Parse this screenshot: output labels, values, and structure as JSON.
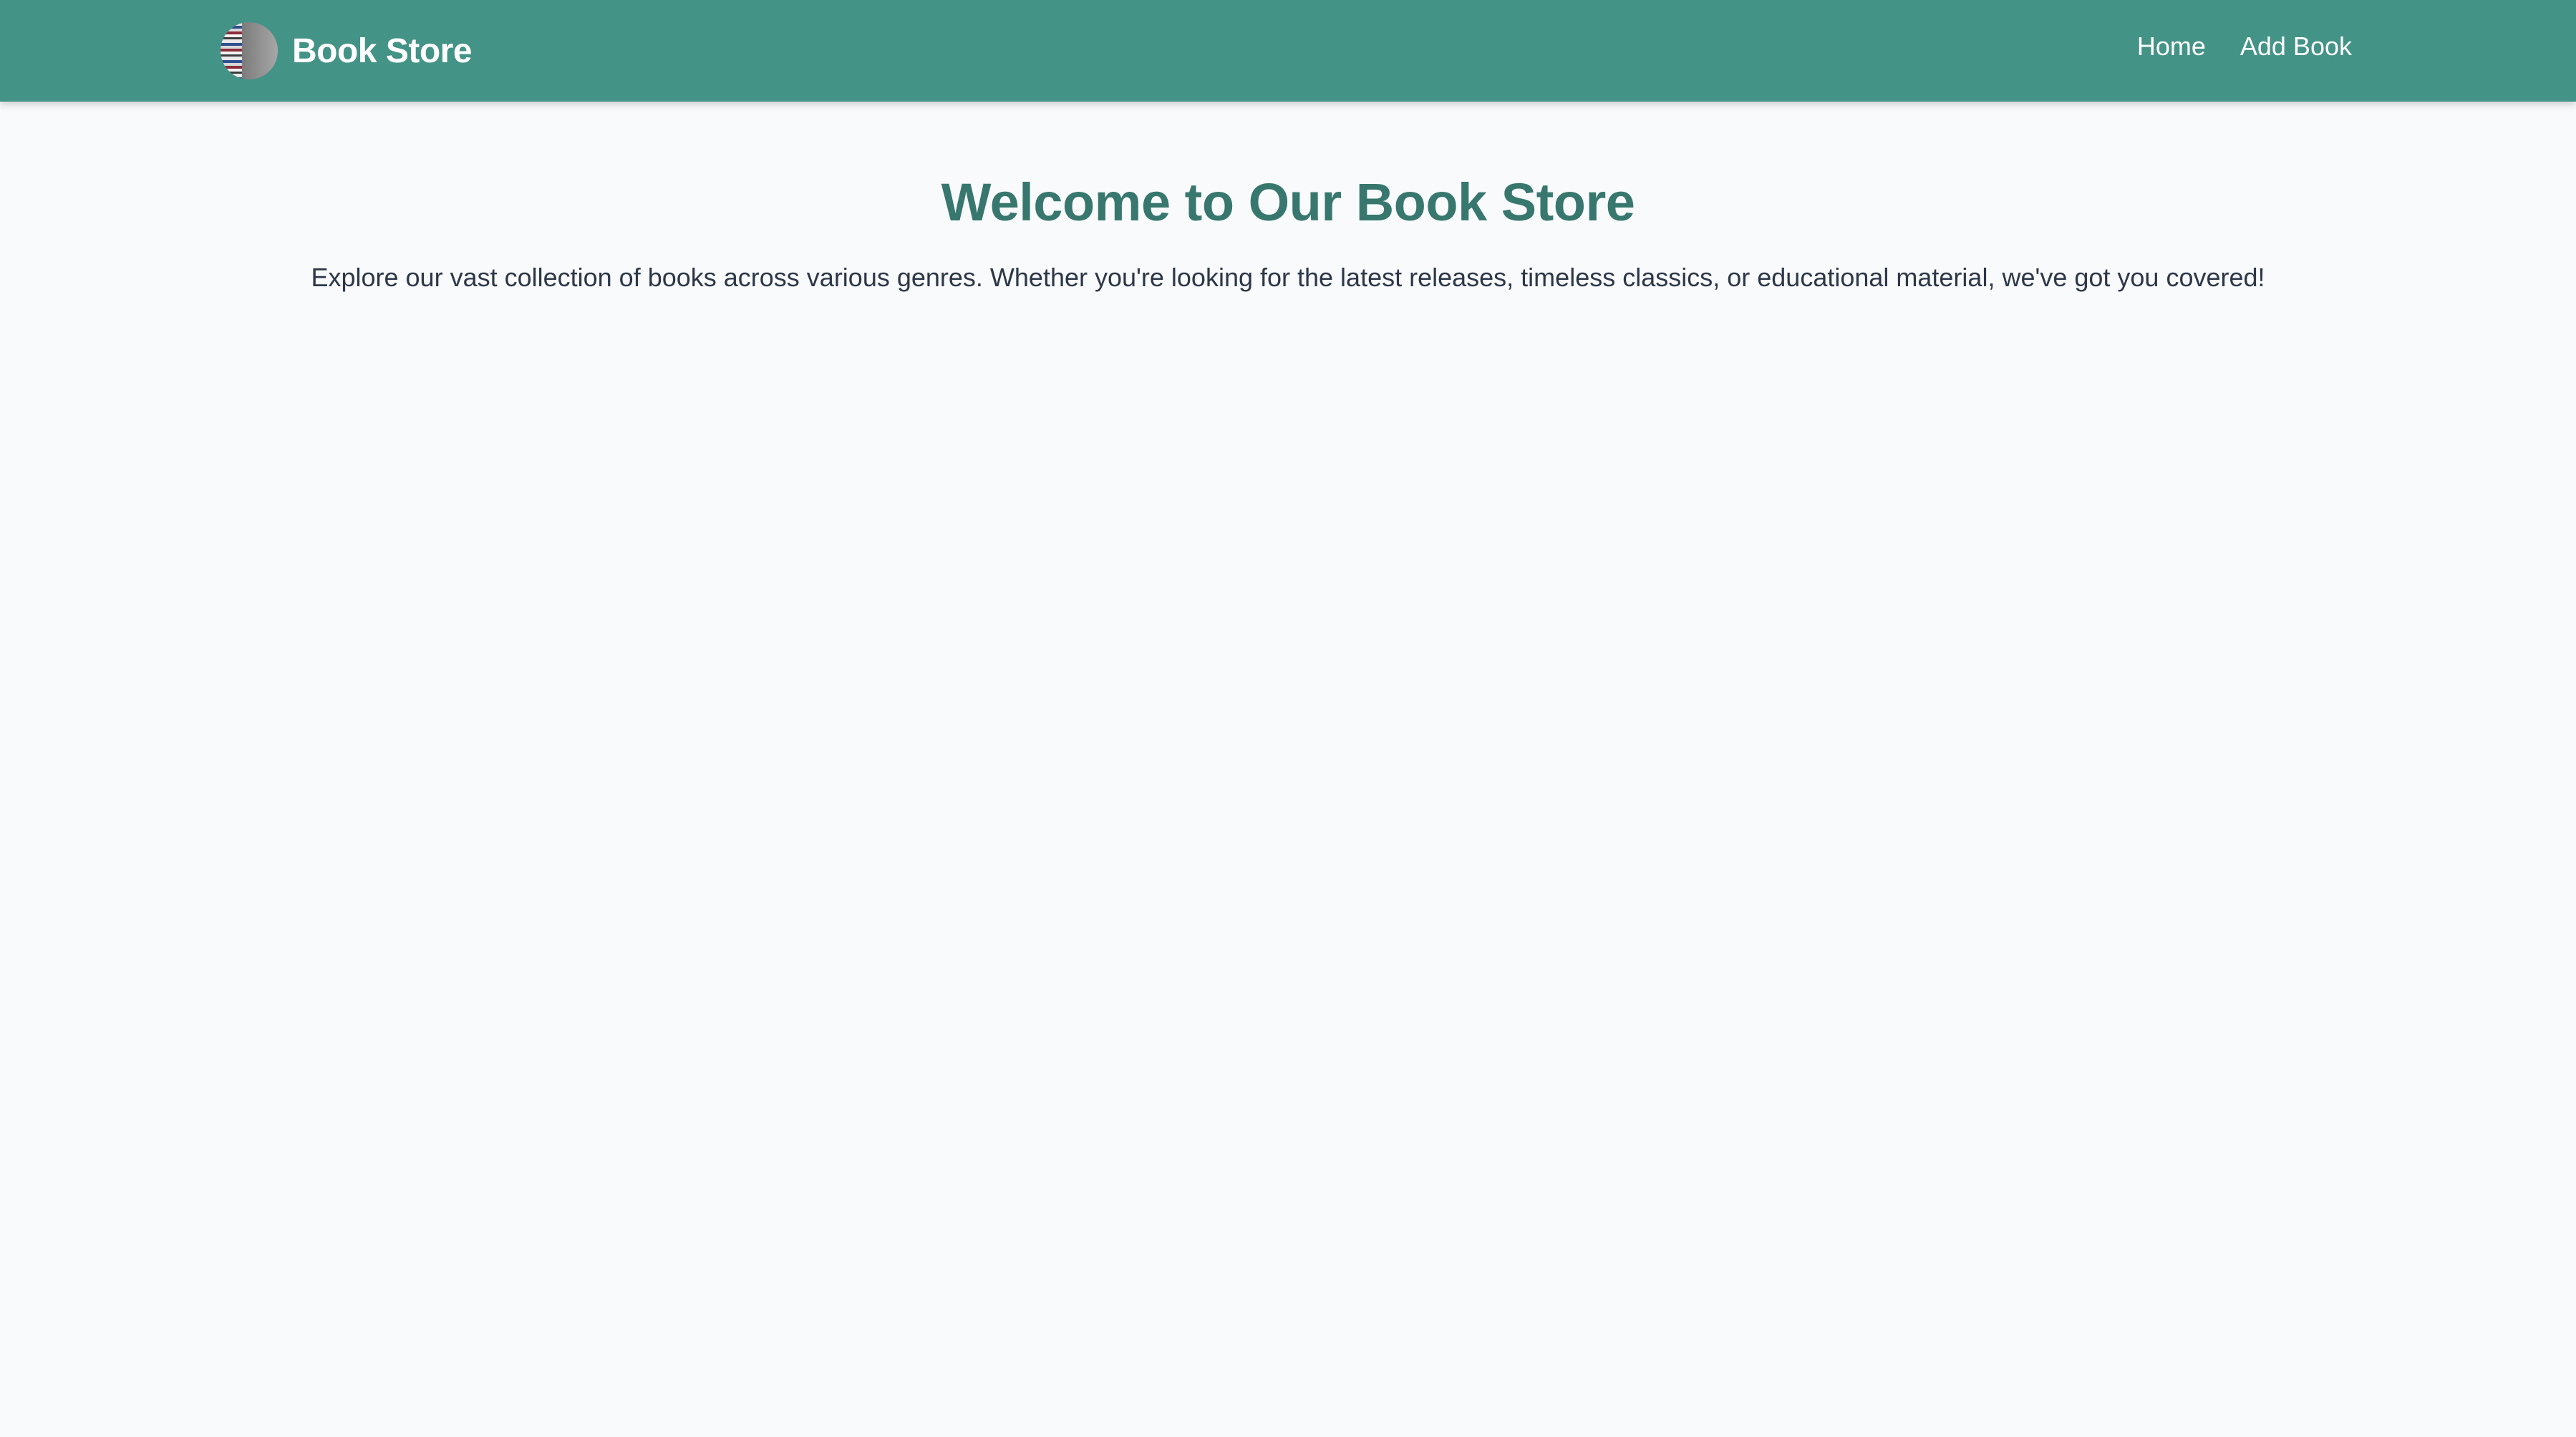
{
  "navbar": {
    "brand": "Book Store",
    "links": [
      {
        "label": "Home"
      },
      {
        "label": "Add Book"
      }
    ],
    "background": "#439386"
  },
  "hero": {
    "title": "Welcome to Our Book Store",
    "description": "Explore our vast collection of books across various genres. Whether you're looking for the latest releases, timeless classics, or educational material, we've got you covered!",
    "title_color": "#38776d"
  },
  "icons": {
    "logo": "bookshelf-logo-icon"
  }
}
